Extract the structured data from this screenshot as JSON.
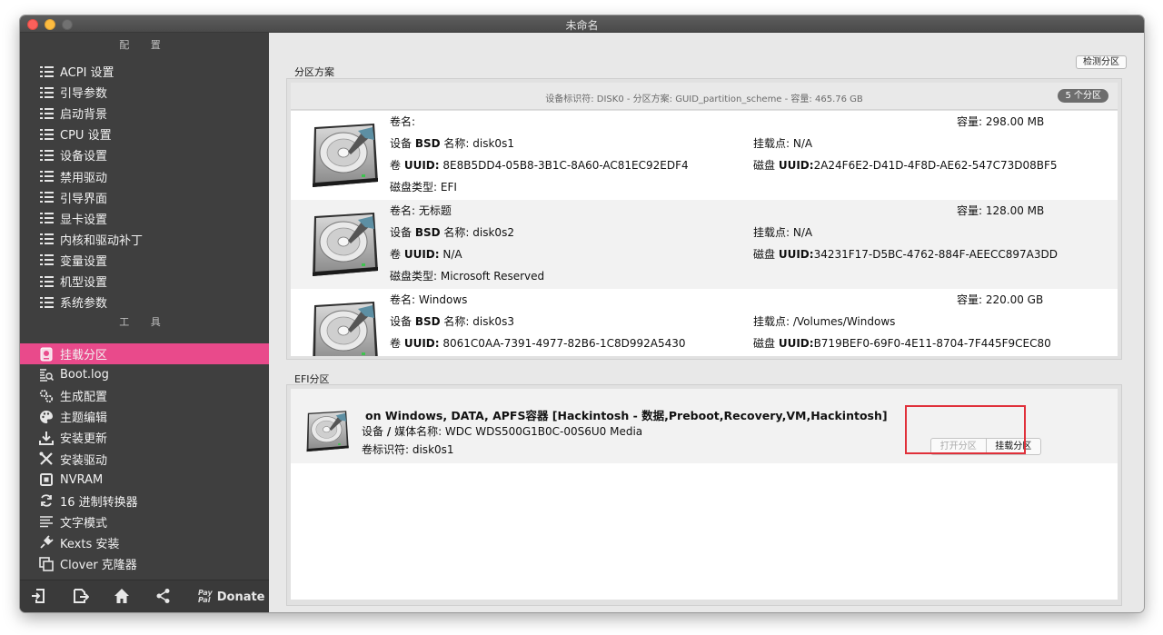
{
  "window": {
    "title": "未命名"
  },
  "sidebar": {
    "config_title": "配 置",
    "config_items": [
      {
        "label": "ACPI 设置",
        "icon": "list-icon"
      },
      {
        "label": "引导参数",
        "icon": "list-icon"
      },
      {
        "label": "启动背景",
        "icon": "list-icon"
      },
      {
        "label": "CPU 设置",
        "icon": "list-icon"
      },
      {
        "label": "设备设置",
        "icon": "list-icon"
      },
      {
        "label": "禁用驱动",
        "icon": "list-icon"
      },
      {
        "label": "引导界面",
        "icon": "list-icon"
      },
      {
        "label": "显卡设置",
        "icon": "list-icon"
      },
      {
        "label": "内核和驱动补丁",
        "icon": "list-icon"
      },
      {
        "label": "变量设置",
        "icon": "list-icon"
      },
      {
        "label": "机型设置",
        "icon": "list-icon"
      },
      {
        "label": "系统参数",
        "icon": "list-icon"
      }
    ],
    "tools_title": "工 具",
    "tool_items": [
      {
        "label": "挂载分区",
        "icon": "mount-disk-icon",
        "active": true
      },
      {
        "label": "Boot.log",
        "icon": "log-search-icon"
      },
      {
        "label": "生成配置",
        "icon": "gears-icon"
      },
      {
        "label": "主题编辑",
        "icon": "palette-icon"
      },
      {
        "label": "安装更新",
        "icon": "download-icon"
      },
      {
        "label": "安装驱动",
        "icon": "tools-icon"
      },
      {
        "label": "NVRAM",
        "icon": "chip-icon"
      },
      {
        "label": "16 进制转换器",
        "icon": "refresh-icon"
      },
      {
        "label": "文字模式",
        "icon": "text-lines-icon"
      },
      {
        "label": "Kexts 安装",
        "icon": "plug-icon"
      },
      {
        "label": "Clover 克隆器",
        "icon": "copy-icon"
      }
    ],
    "footer": {
      "icons": [
        "import-icon",
        "export-icon",
        "home-icon",
        "share-icon"
      ],
      "paypal_top": "Pay",
      "paypal_bottom": "Pal",
      "donate_label": "Donate"
    }
  },
  "main": {
    "partition_group_label": "分区方案",
    "detect_button": "检测分区",
    "disk_info": "设备标识符: DISK0 - 分区方案: GUID_partition_scheme - 容量: 465.76 GB",
    "partition_count": "5 个分区",
    "labels": {
      "volume_name": "卷名: ",
      "bsd_prefix": "设备",
      "bsd_bold": "BSD",
      "bsd_suffix": "名称: ",
      "volume_uuid_prefix": "卷",
      "volume_uuid_bold": "UUID:",
      "disk_type": "磁盘类型: ",
      "capacity": "容量: ",
      "mount_point": "挂载点: ",
      "disk_uuid_prefix": "磁盘",
      "disk_uuid_bold": "UUID:"
    },
    "partitions": [
      {
        "volume_name": "",
        "bsd_name": "disk0s1",
        "volume_uuid": "8E8B5DD4-05B8-3B1C-8A60-AC81EC92EDF4",
        "disk_type": "EFI",
        "capacity": "298.00 MB",
        "mount_point": "N/A",
        "disk_uuid": "2A24F6E2-D41D-4F8D-AE62-547C73D08BF5"
      },
      {
        "volume_name": "无标题",
        "bsd_name": "disk0s2",
        "volume_uuid": "N/A",
        "disk_type": "Microsoft Reserved",
        "capacity": "128.00 MB",
        "mount_point": "N/A",
        "disk_uuid": "34231F17-D5BC-4762-884F-AEECC897A3DD"
      },
      {
        "volume_name": "Windows",
        "bsd_name": "disk0s3",
        "volume_uuid": "8061C0AA-7391-4977-82B6-1C8D992A5430",
        "disk_type": "",
        "capacity": "220.00 GB",
        "mount_point": "/Volumes/Windows",
        "disk_uuid": "B719BEF0-69F0-4E11-8704-7F445F9CEC80"
      }
    ],
    "efi_group_label": "EFI分区",
    "efi": {
      "title": "on Windows, DATA, APFS容器 [Hackintosh - 数据,Preboot,Recovery,VM,Hackintosh]",
      "device_label_prefix": "设备",
      "device_label_bold": "/",
      "device_label_suffix": "媒体名称: ",
      "device_value": "WDC WDS500G1B0C-00S6U0 Media",
      "volume_id_label": "卷标识符: ",
      "volume_id_value": "disk0s1",
      "open_button": "打开分区",
      "mount_button": "挂载分区"
    }
  }
}
